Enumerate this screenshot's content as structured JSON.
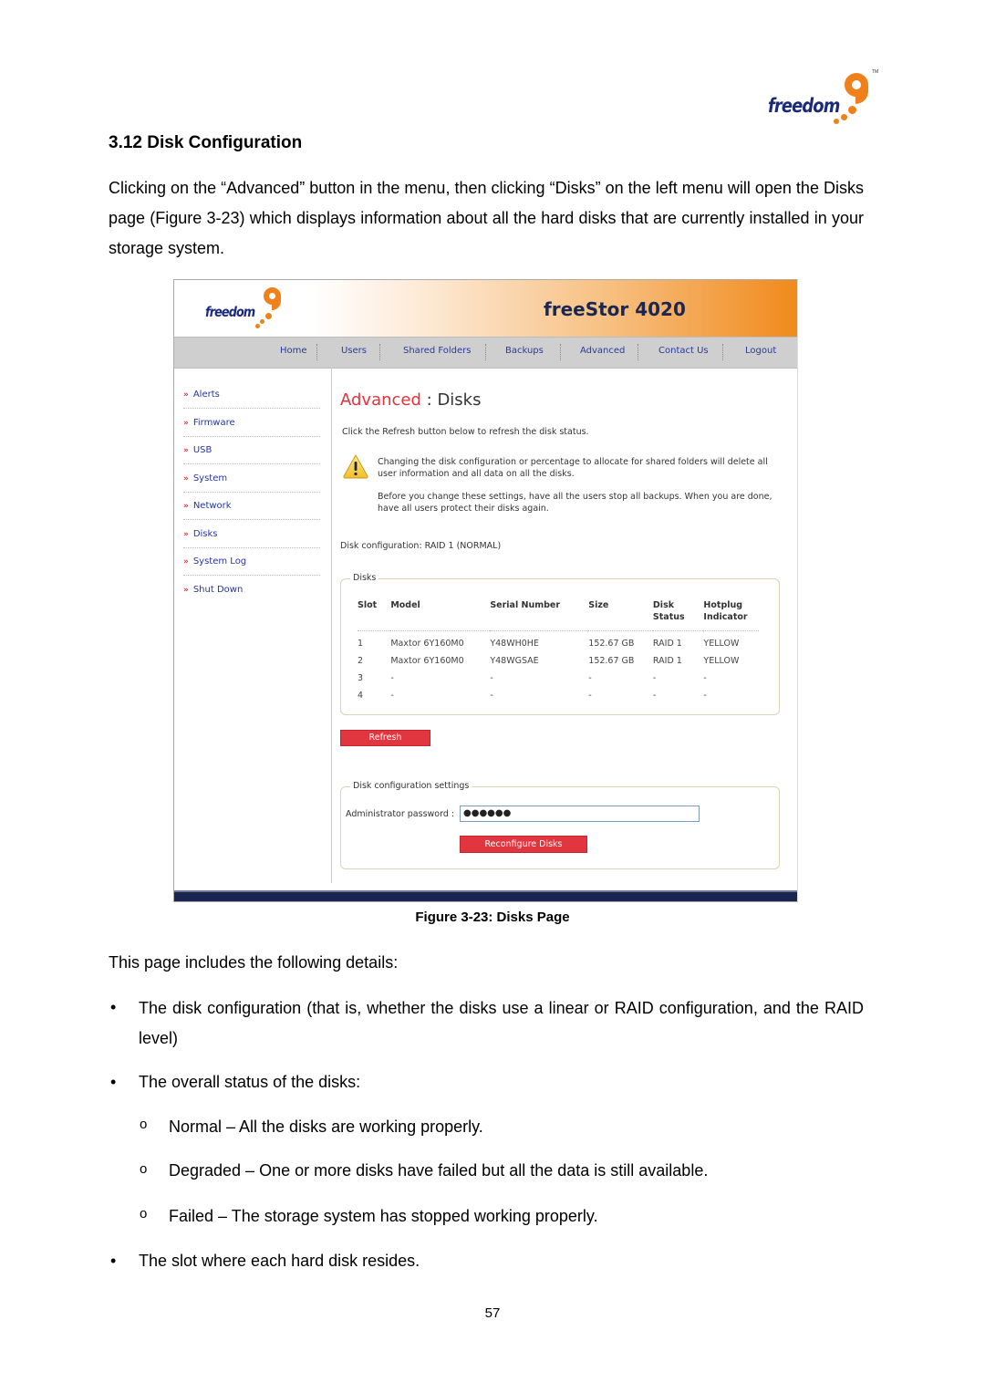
{
  "document": {
    "logo": {
      "word": "freedom",
      "tm": "TM",
      "accent_color": "#f08019",
      "text_color": "#1b2a78"
    },
    "section_title": "3.12  Disk Configuration",
    "intro": "Clicking on the “Advanced” button in the menu, then clicking “Disks” on the left menu will open the Disks page (Figure 3-23) which displays information about all the hard disks that are currently installed in your storage system.",
    "caption": "Figure 3-23: Disks Page",
    "details_intro": "This page includes the following details:",
    "bullets": [
      "The disk configuration (that is, whether the disks use a linear or RAID configuration, and the RAID level)",
      "The overall status of the disks:",
      "The slot where each hard disk resides."
    ],
    "sub_bullets": [
      "Normal – All the disks are working properly.",
      "Degraded – One or more disks have failed but all the data is still available.",
      "Failed – The storage system has stopped working properly."
    ],
    "bullet_glyph": "•",
    "sub_bullet_glyph": "o",
    "page_number": "57"
  },
  "screenshot": {
    "logo_word": "freedom",
    "product_name": "freeStor 4020",
    "nav": [
      "Home",
      "Users",
      "Shared Folders",
      "Backups",
      "Advanced",
      "Contact Us",
      "Logout"
    ],
    "sidebar": {
      "chevron": "»",
      "items": [
        "Alerts",
        "Firmware",
        "USB",
        "System",
        "Network",
        "Disks",
        "System Log",
        "Shut Down"
      ]
    },
    "heading": {
      "section": "Advanced",
      "separator": " : ",
      "page": "Disks"
    },
    "refresh_hint": "Click the Refresh button below to refresh the disk status.",
    "warning_1": "Changing the disk configuration or percentage to allocate for shared folders will delete all user information and all data on all the disks.",
    "warning_2": "Before you change these settings, have all the users stop all backups. When you are done, have all users protect their disks again.",
    "disk_configuration": "Disk configuration: RAID 1 (NORMAL)",
    "disks_group": {
      "legend": "Disks",
      "columns": [
        "Slot",
        "Model",
        "Serial Number",
        "Size",
        "Disk Status",
        "Hotplug Indicator"
      ],
      "rows": [
        [
          "1",
          "Maxtor 6Y160M0",
          "Y48WH0HE",
          "152.67 GB",
          "RAID 1",
          "YELLOW"
        ],
        [
          "2",
          "Maxtor 6Y160M0",
          "Y48WGSAE",
          "152.67 GB",
          "RAID 1",
          "YELLOW"
        ],
        [
          "3",
          "-",
          "-",
          "-",
          "-",
          "-"
        ],
        [
          "4",
          "-",
          "-",
          "-",
          "-",
          "-"
        ]
      ]
    },
    "refresh_button": "Refresh",
    "settings_group": {
      "legend": "Disk configuration settings",
      "password_label": "Administrator password :",
      "password_value": "●●●●●●",
      "reconfigure_button": "Reconfigure Disks"
    },
    "colors": {
      "accent_red": "#e1363f",
      "link_blue": "#27359a",
      "banner_orange": "#f08a1c",
      "footer_navy": "#1a2450"
    }
  }
}
